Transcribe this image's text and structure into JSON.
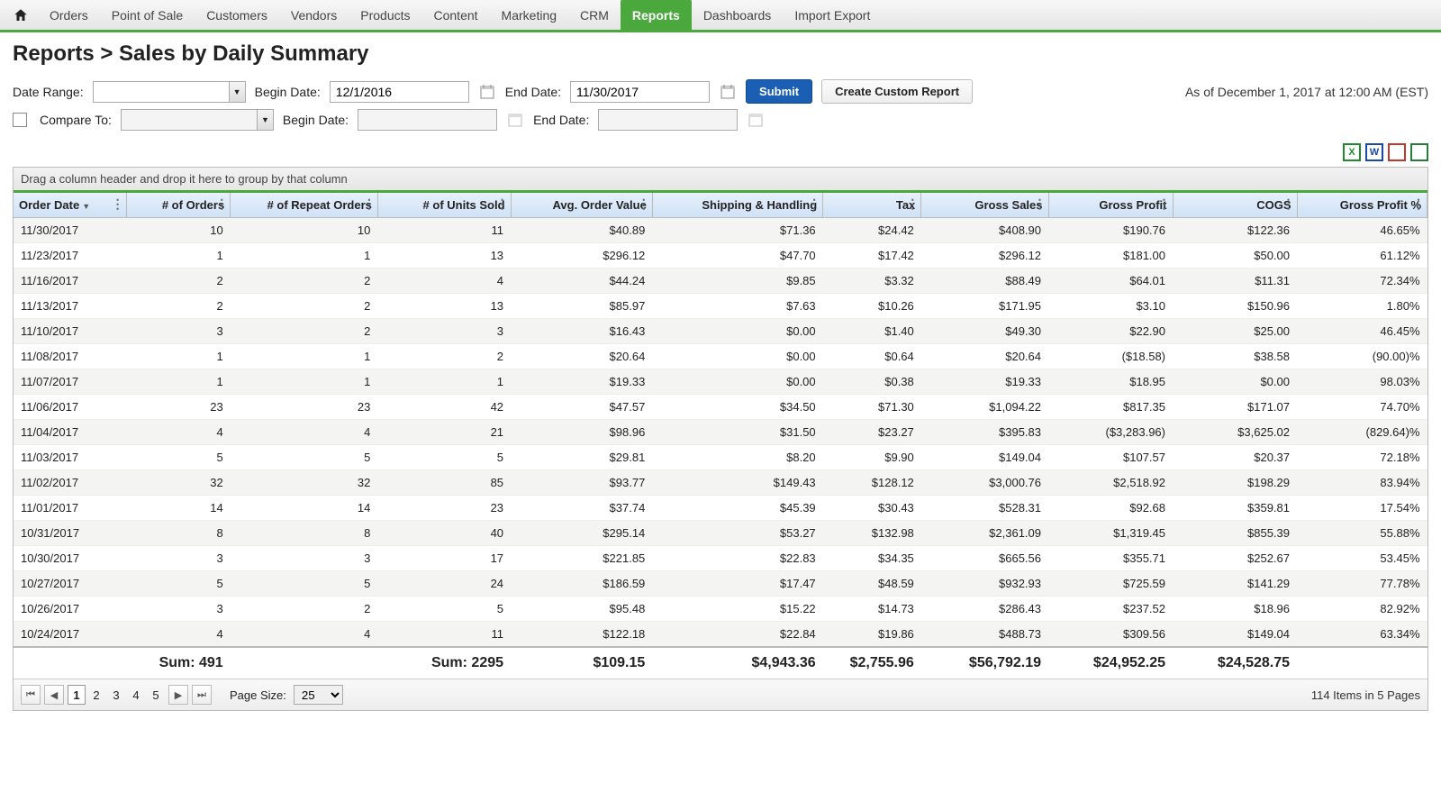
{
  "nav": {
    "items": [
      "Orders",
      "Point of Sale",
      "Customers",
      "Vendors",
      "Products",
      "Content",
      "Marketing",
      "CRM",
      "Reports",
      "Dashboards",
      "Import Export"
    ],
    "active": "Reports"
  },
  "breadcrumb": {
    "root": "Reports",
    "sep": ">",
    "leaf": "Sales by Daily Summary"
  },
  "filters": {
    "daterange_label": "Date Range:",
    "begin_label": "Begin Date:",
    "end_label": "End Date:",
    "begin_value": "12/1/2016",
    "end_value": "11/30/2017",
    "compare_label": "Compare To:",
    "submit": "Submit",
    "custom": "Create Custom Report",
    "asof": "As of December 1, 2017 at 12:00 AM (EST)"
  },
  "export_icons": [
    {
      "name": "excel-icon",
      "letter": "X",
      "color": "#1f8b2c"
    },
    {
      "name": "word-icon",
      "letter": "W",
      "color": "#1a4aa8"
    },
    {
      "name": "pdf-icon",
      "letter": "",
      "color": "#c0392b"
    },
    {
      "name": "csv-icon",
      "letter": "",
      "color": "#2a7a3c"
    }
  ],
  "grid": {
    "group_hint": "Drag a column header and drop it here to group by that column",
    "columns": [
      {
        "key": "date",
        "label": "Order Date",
        "width": "7.8%",
        "sorted": "desc"
      },
      {
        "key": "orders",
        "label": "# of Orders",
        "width": "7.2%"
      },
      {
        "key": "repeat",
        "label": "# of Repeat Orders",
        "width": "10.2%"
      },
      {
        "key": "units",
        "label": "# of Units Sold",
        "width": "9.2%"
      },
      {
        "key": "avg",
        "label": "Avg. Order Value",
        "width": "9.8%"
      },
      {
        "key": "ship",
        "label": "Shipping & Handling",
        "width": "11.8%"
      },
      {
        "key": "tax",
        "label": "Tax",
        "width": "6.8%"
      },
      {
        "key": "gsales",
        "label": "Gross Sales",
        "width": "8.8%"
      },
      {
        "key": "gprofit",
        "label": "Gross Profit",
        "width": "8.6%"
      },
      {
        "key": "cogs",
        "label": "COGS",
        "width": "8.6%"
      },
      {
        "key": "gpp",
        "label": "Gross Profit %",
        "width": "9.0%"
      }
    ],
    "rows": [
      {
        "date": "11/30/2017",
        "orders": "10",
        "repeat": "10",
        "units": "11",
        "avg": "$40.89",
        "ship": "$71.36",
        "tax": "$24.42",
        "gsales": "$408.90",
        "gprofit": "$190.76",
        "cogs": "$122.36",
        "gpp": "46.65%"
      },
      {
        "date": "11/23/2017",
        "orders": "1",
        "repeat": "1",
        "units": "13",
        "avg": "$296.12",
        "ship": "$47.70",
        "tax": "$17.42",
        "gsales": "$296.12",
        "gprofit": "$181.00",
        "cogs": "$50.00",
        "gpp": "61.12%"
      },
      {
        "date": "11/16/2017",
        "orders": "2",
        "repeat": "2",
        "units": "4",
        "avg": "$44.24",
        "ship": "$9.85",
        "tax": "$3.32",
        "gsales": "$88.49",
        "gprofit": "$64.01",
        "cogs": "$11.31",
        "gpp": "72.34%"
      },
      {
        "date": "11/13/2017",
        "orders": "2",
        "repeat": "2",
        "units": "13",
        "avg": "$85.97",
        "ship": "$7.63",
        "tax": "$10.26",
        "gsales": "$171.95",
        "gprofit": "$3.10",
        "cogs": "$150.96",
        "gpp": "1.80%"
      },
      {
        "date": "11/10/2017",
        "orders": "3",
        "repeat": "2",
        "units": "3",
        "avg": "$16.43",
        "ship": "$0.00",
        "tax": "$1.40",
        "gsales": "$49.30",
        "gprofit": "$22.90",
        "cogs": "$25.00",
        "gpp": "46.45%"
      },
      {
        "date": "11/08/2017",
        "orders": "1",
        "repeat": "1",
        "units": "2",
        "avg": "$20.64",
        "ship": "$0.00",
        "tax": "$0.64",
        "gsales": "$20.64",
        "gprofit": "($18.58)",
        "cogs": "$38.58",
        "gpp": "(90.00)%"
      },
      {
        "date": "11/07/2017",
        "orders": "1",
        "repeat": "1",
        "units": "1",
        "avg": "$19.33",
        "ship": "$0.00",
        "tax": "$0.38",
        "gsales": "$19.33",
        "gprofit": "$18.95",
        "cogs": "$0.00",
        "gpp": "98.03%"
      },
      {
        "date": "11/06/2017",
        "orders": "23",
        "repeat": "23",
        "units": "42",
        "avg": "$47.57",
        "ship": "$34.50",
        "tax": "$71.30",
        "gsales": "$1,094.22",
        "gprofit": "$817.35",
        "cogs": "$171.07",
        "gpp": "74.70%"
      },
      {
        "date": "11/04/2017",
        "orders": "4",
        "repeat": "4",
        "units": "21",
        "avg": "$98.96",
        "ship": "$31.50",
        "tax": "$23.27",
        "gsales": "$395.83",
        "gprofit": "($3,283.96)",
        "cogs": "$3,625.02",
        "gpp": "(829.64)%"
      },
      {
        "date": "11/03/2017",
        "orders": "5",
        "repeat": "5",
        "units": "5",
        "avg": "$29.81",
        "ship": "$8.20",
        "tax": "$9.90",
        "gsales": "$149.04",
        "gprofit": "$107.57",
        "cogs": "$20.37",
        "gpp": "72.18%"
      },
      {
        "date": "11/02/2017",
        "orders": "32",
        "repeat": "32",
        "units": "85",
        "avg": "$93.77",
        "ship": "$149.43",
        "tax": "$128.12",
        "gsales": "$3,000.76",
        "gprofit": "$2,518.92",
        "cogs": "$198.29",
        "gpp": "83.94%"
      },
      {
        "date": "11/01/2017",
        "orders": "14",
        "repeat": "14",
        "units": "23",
        "avg": "$37.74",
        "ship": "$45.39",
        "tax": "$30.43",
        "gsales": "$528.31",
        "gprofit": "$92.68",
        "cogs": "$359.81",
        "gpp": "17.54%"
      },
      {
        "date": "10/31/2017",
        "orders": "8",
        "repeat": "8",
        "units": "40",
        "avg": "$295.14",
        "ship": "$53.27",
        "tax": "$132.98",
        "gsales": "$2,361.09",
        "gprofit": "$1,319.45",
        "cogs": "$855.39",
        "gpp": "55.88%"
      },
      {
        "date": "10/30/2017",
        "orders": "3",
        "repeat": "3",
        "units": "17",
        "avg": "$221.85",
        "ship": "$22.83",
        "tax": "$34.35",
        "gsales": "$665.56",
        "gprofit": "$355.71",
        "cogs": "$252.67",
        "gpp": "53.45%"
      },
      {
        "date": "10/27/2017",
        "orders": "5",
        "repeat": "5",
        "units": "24",
        "avg": "$186.59",
        "ship": "$17.47",
        "tax": "$48.59",
        "gsales": "$932.93",
        "gprofit": "$725.59",
        "cogs": "$141.29",
        "gpp": "77.78%"
      },
      {
        "date": "10/26/2017",
        "orders": "3",
        "repeat": "2",
        "units": "5",
        "avg": "$95.48",
        "ship": "$15.22",
        "tax": "$14.73",
        "gsales": "$286.43",
        "gprofit": "$237.52",
        "cogs": "$18.96",
        "gpp": "82.92%"
      },
      {
        "date": "10/24/2017",
        "orders": "4",
        "repeat": "4",
        "units": "11",
        "avg": "$122.18",
        "ship": "$22.84",
        "tax": "$19.86",
        "gsales": "$488.73",
        "gprofit": "$309.56",
        "cogs": "$149.04",
        "gpp": "63.34%"
      }
    ],
    "footer": {
      "orders_sum": "Sum: 491",
      "units_sum": "Sum: 2295",
      "avg": "$109.15",
      "ship": "$4,943.36",
      "tax": "$2,755.96",
      "gsales": "$56,792.19",
      "gprofit": "$24,952.25",
      "cogs": "$24,528.75"
    }
  },
  "pager": {
    "pages": [
      "1",
      "2",
      "3",
      "4",
      "5"
    ],
    "current": "1",
    "size_label": "Page Size:",
    "size": "25",
    "info": "114 Items in 5 Pages"
  }
}
